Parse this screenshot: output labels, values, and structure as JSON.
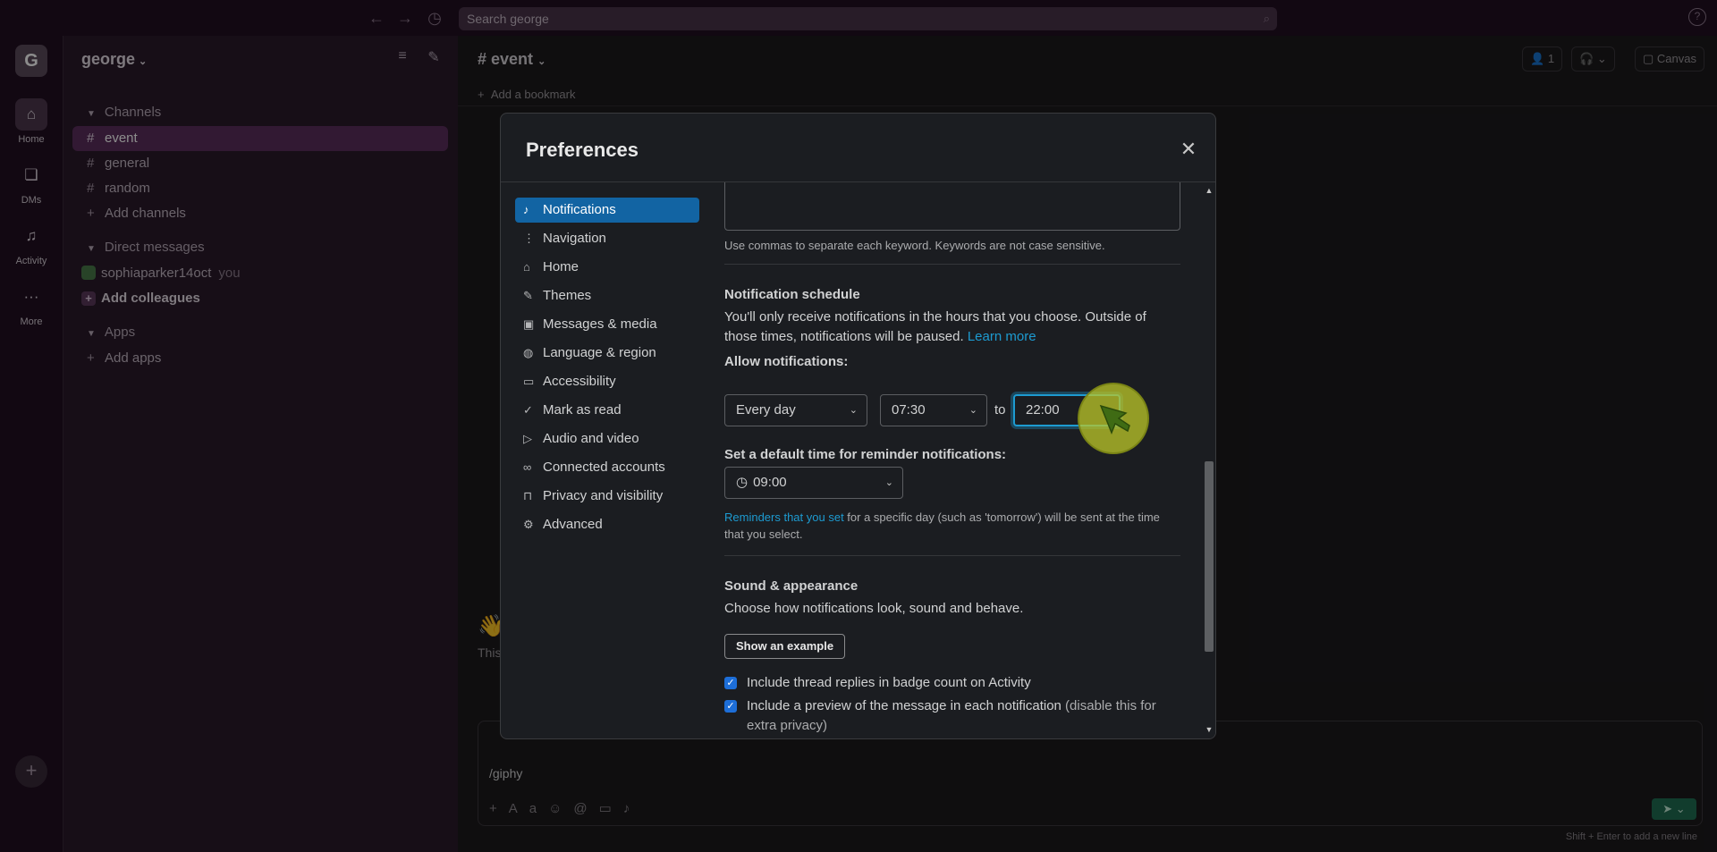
{
  "topbar": {
    "back_icon": "arrow-left-icon",
    "forward_icon": "arrow-right-icon",
    "history_icon": "clock-icon",
    "search_placeholder": "Search george",
    "help_icon": "help-icon"
  },
  "rail": {
    "workspace_initial": "G",
    "items": [
      {
        "label": "Home"
      },
      {
        "label": "DMs"
      },
      {
        "label": "Activity"
      },
      {
        "label": "More"
      }
    ]
  },
  "sidebar": {
    "workspace_name": "george",
    "channels_heading": "Channels",
    "channels": [
      {
        "name": "event"
      },
      {
        "name": "general"
      },
      {
        "name": "random"
      }
    ],
    "add_channels": "Add channels",
    "dm_heading": "Direct messages",
    "dm_user": "sophiaparker14oct",
    "dm_you": "you",
    "add_colleagues": "Add colleagues",
    "apps_heading": "Apps",
    "add_apps": "Add apps"
  },
  "main": {
    "channel_title": "# event",
    "add_bookmark": "Add a bookmark",
    "members_count": "1",
    "canvas_label": "Canvas",
    "behind_text": "This",
    "composer_text": "/giphy",
    "hint": "Shift + Enter to add a new line"
  },
  "modal": {
    "title": "Preferences",
    "menu": [
      {
        "label": "Notifications"
      },
      {
        "label": "Navigation"
      },
      {
        "label": "Home"
      },
      {
        "label": "Themes"
      },
      {
        "label": "Messages & media"
      },
      {
        "label": "Language & region"
      },
      {
        "label": "Accessibility"
      },
      {
        "label": "Mark as read"
      },
      {
        "label": "Audio and video"
      },
      {
        "label": "Connected accounts"
      },
      {
        "label": "Privacy and visibility"
      },
      {
        "label": "Advanced"
      }
    ],
    "keywords_help": "Use commas to separate each keyword. Keywords are not case sensitive.",
    "schedule_heading": "Notification schedule",
    "schedule_text": "You'll only receive notifications in the hours that you choose. Outside of those times, notifications will be paused.",
    "learn_more": "Learn more",
    "allow_label": "Allow notifications:",
    "days_value": "Every day",
    "from_value": "07:30",
    "to_word": "to",
    "to_value": "22:00",
    "reminder_label": "Set a default time for reminder notifications:",
    "reminder_value": "09:00",
    "reminder_link": "Reminders that you set",
    "reminder_text": " for a specific day (such as 'tomorrow') will be sent at the time that you select.",
    "sound_heading": "Sound & appearance",
    "sound_text": "Choose how notifications look, sound and behave.",
    "show_example": "Show an example",
    "cb1": "Include thread replies in badge count on Activity",
    "cb2_main": "Include a preview of the message in each notification",
    "cb2_muted": " (disable this for extra privacy)"
  }
}
